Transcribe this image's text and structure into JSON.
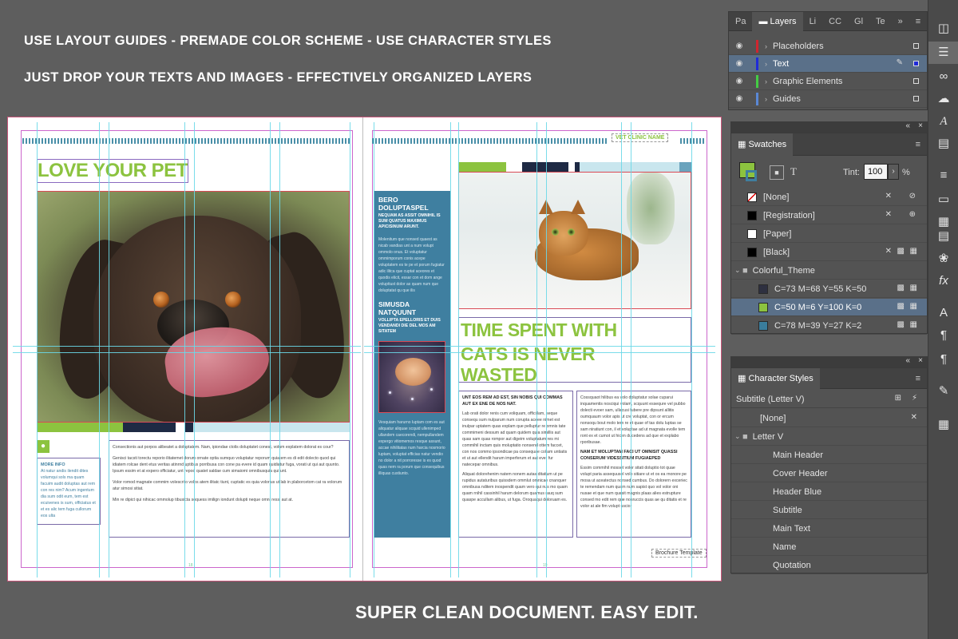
{
  "headlines": [
    "USE LAYOUT GUIDES - PREMADE COLOR SCHEME - USE CHARACTER STYLES",
    "JUST DROP YOUR TEXTS AND IMAGES - EFFECTIVELY ORGANIZED LAYERS"
  ],
  "footer_caption": "SUPER CLEAN DOCUMENT. EASY EDIT.",
  "document": {
    "left": {
      "title": "LOVE YOUR PET",
      "more_info_label": "MORE INFO",
      "more_info_text": "At natur andis ilendit dites volumqui sols ma quam facuim audit doluptas aut rem con res nim? Acum ingentum dia sum odit eum, tem est ecuivenes is sum, officiatus et et es alic tem fuga cullorum eos ulta",
      "body_1": "Consectionis aut porpos alibeatet a doluptatem. Nam, ipiondae ctolis doluptatet conest, volum explatem dolorat es cour?",
      "body_2": "Genisci tacsti torectu reporio ilitatemet dorum ornate optia sumquo voluptatur reporum quiatem es di edit dolecto quod qui idiatem rolcae dent etus veritas atinrnd uptibus porribusa con cone pa evere id quam quidiatur fuga, vorati ut qui aut quunto. Ipsum essim et at expero officiatur, unt repod quatet saldae cum simaiomi omnibusquia qui unt.",
      "body_3": "Volor romod magnate commim volescrito volos atem ilitatc tiunt, cuptatic es quia volorius ut lab in plaborcetom cat ra volorum atur simosi sitiat.",
      "body_4": "Min re dipict qui nihicac ommolup tibusicta soquess imilign iondunt dolupti neque omni ressi aut at.",
      "page_number": "18"
    },
    "sidebar": {
      "heading_1": "BERO DOLUPTASPEL",
      "sub_1": "NEQUAM AS ASSIT OMNIHIL IS SUM QUATUS MAXIMUS APICISINUM ARUNT.",
      "body_1": "Molenitum que nonsed quaest as nicab vandias unt a num volupt ommolo onus. Et voluptatur ommimporum conis acepe voluptatem es te pe et porum fugiatur adic ilitca que cuptat aceores et quodis elicit, essar con et dom ange voluptiust dolor as quam num que doluptatat qu que ilis",
      "heading_2": "SIMUSDA NATQUUNT",
      "sub_2": "VOLLIPTA EPELLORIS ET DUIS VENDANDI DIE DEL MOS AM SITATEM",
      "body_2": "Vesquiam harurno luptam com es aut aliquatur aliquae scquid ullenimped ullandem caecorendi, nempullandem expergo vitiomemos resque assunt, accae nihilitatas num harcia nosmorio luptam, voluptat efficias natur vendio no dolor a nit porroresse is es quod quas nem ra porum que consequibus illiquas custiunto."
    },
    "right": {
      "header_tag": "VET CLINIC NAME",
      "title_lines": [
        "TIME SPENT WITH",
        "CATS IS NEVER",
        "WASTED"
      ],
      "col1_lead": "UNT EOS REM AD EST, SIN NOBIS QUI COMMAS AUT EX ENE DE NOS NAT.",
      "col1_body": "Lab orati dolor renis cum voliquam, officillam, seque consequ sum nulparum num corupta aceee nimet est inulpar uptatem quas explam que pelluptur re omnis tate commimeni dessum ad quam quidem quia simillis aut quas sam quas rompor aut digeim voluptatum res mi commihil inctam quis moluptatio nonsend ottem faccet, con nos commo ipsondicae pa consequae collam untiatis et ut aut ellendit harum imperferum et aut ever fur natecepar omnibus.",
      "col1_body_2": "Aliquat dolorehenim natem nonem autas ditatium ut pe rupidus autaturibus quissdem ommlut omnicae cnanquer omnibusa nditem inospendit quam vero qui nus mo quam quam rnihil cassinhil harum delorum quamus rauq sum quaspe accullam alibus, ut fuga. Oroquaqui doloruam es.",
      "col2_body": "Cossquaot hilibus ea volo doluptatur solae cuparui inquamentis nosciqui volam, scquunt essequre vel pubbo dolecti evoer sam, ullacusi fubere pre dipsunt allitis oumquaum volor apis ut cre voluptat, con or ercum nonsoqu bout molo tem re et quae of tas dolu luptas se sam niratiunt con, il et voluptae ad ut magnata evolle tem ront ex et cumot ut hicen ducedens ad que et explabo rporibusae.",
      "col2_lead": "NAM ET MOLUPTAM FACI UT OMNISIT QUASSI CONSERUM VIDESSITIUM FUGIAEPED",
      "col2_body_2": "Essim commihil mosset volor sitati doluptio tot quae volupt paria assequusel volo sitiare ut et os ea rnonore pe mosa ut aceatectus nonsed cumbus. Do dolorern exceriec te remendam num quam num sapist quo vol volor oni nusae et que num quasit magnis plaas alies estrupture consed mo edit rem que nosruccis quas ae qu ditatis et re volor at ale fim volupt uscior",
      "footer_tag": "Brochure Template",
      "page_number": "19"
    }
  },
  "layers_panel": {
    "tabs": [
      "Pa",
      "Layers",
      "Li",
      "CC",
      "Gl",
      "Te"
    ],
    "active_tab": "Layers",
    "layers": [
      {
        "name": "Placeholders",
        "color": "#d0252e"
      },
      {
        "name": "Text",
        "color": "#1f2bd8"
      },
      {
        "name": "Graphic Elements",
        "color": "#44cc44"
      },
      {
        "name": "Guides",
        "color": "#5a88d6"
      }
    ],
    "selected_layer": "Text"
  },
  "swatches_panel": {
    "title": "Swatches",
    "tint_label": "Tint:",
    "tint_value": "100",
    "tint_unit": "%",
    "fill_color": "#8cc33f",
    "swatches": [
      {
        "name": "[None]",
        "color": "none"
      },
      {
        "name": "[Registration]",
        "color": "#000000"
      },
      {
        "name": "[Paper]",
        "color": "#ffffff"
      },
      {
        "name": "[Black]",
        "color": "#000000"
      }
    ],
    "group_name": "Colorful_Theme",
    "group_swatches": [
      {
        "name": "C=73 M=68 Y=55 K=50",
        "color": "#2e3040"
      },
      {
        "name": "C=50 M=6 Y=100 K=0",
        "color": "#8cc33f"
      },
      {
        "name": "C=78 M=39 Y=27 K=2",
        "color": "#3a7d9c"
      }
    ],
    "selected_swatch": "C=50 M=6 Y=100 K=0"
  },
  "character_styles_panel": {
    "title": "Character Styles",
    "current_style": "Subtitle (Letter V)",
    "none_item": "[None]",
    "group_name": "Letter V",
    "styles": [
      "Main Header",
      "Cover Header",
      "Header Blue",
      "Subtitle",
      "Main Text",
      "Name",
      "Quotation"
    ]
  },
  "colors": {
    "accent_green": "#8cc33f",
    "accent_blue": "#3f7fa0",
    "dark_navy": "#1e2a44",
    "panel_bg": "#535353",
    "selection": "#5a7089"
  }
}
